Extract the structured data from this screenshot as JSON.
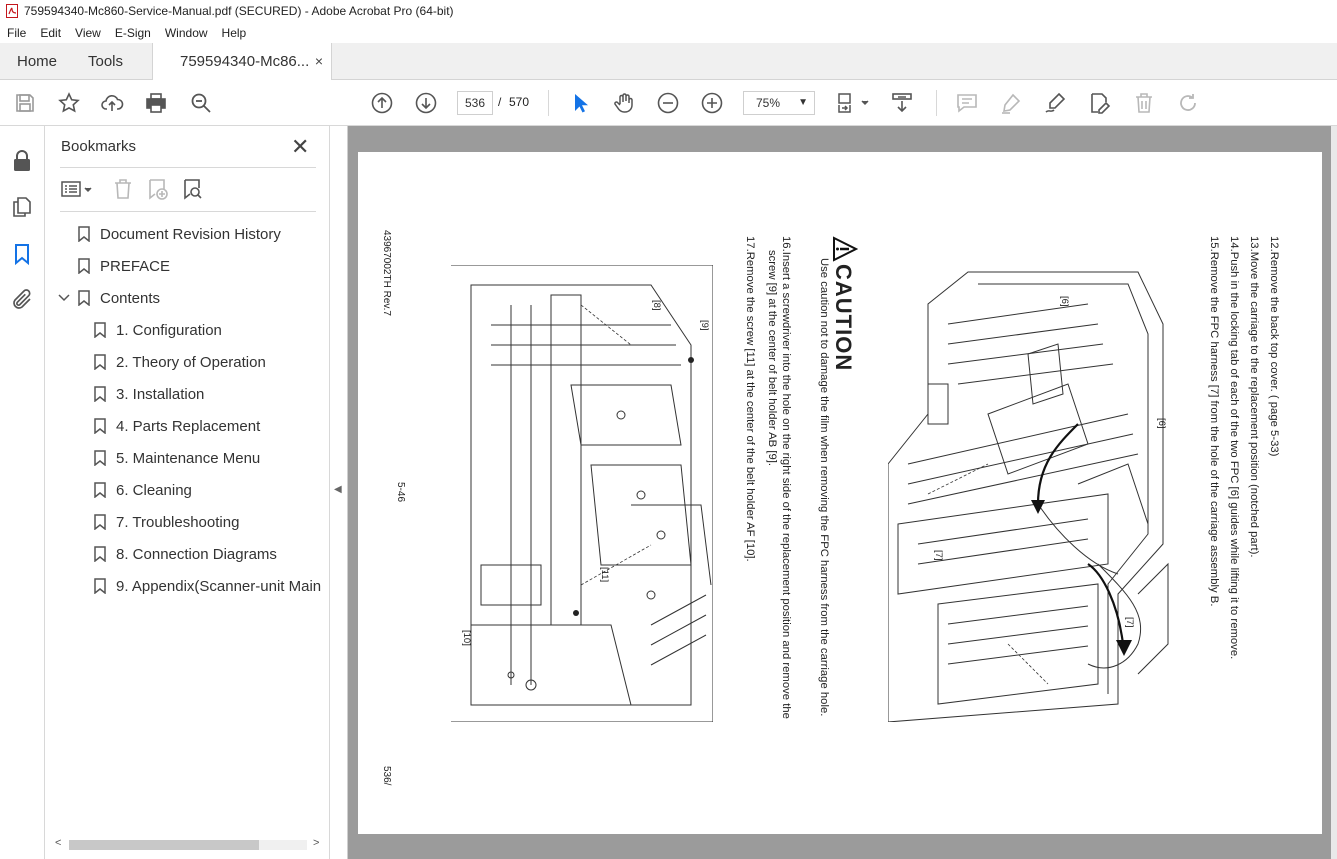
{
  "window": {
    "title": "759594340-Mc860-Service-Manual.pdf (SECURED) - Adobe Acrobat Pro (64-bit)"
  },
  "menu": [
    "File",
    "Edit",
    "View",
    "E-Sign",
    "Window",
    "Help"
  ],
  "tabs": {
    "home": "Home",
    "tools": "Tools",
    "document": "759594340-Mc86...",
    "close": "×"
  },
  "toolbar": {
    "current_page": "536",
    "separator": "/",
    "total_pages": "570",
    "zoom": "75%",
    "icons": [
      "save-icon",
      "star-icon",
      "upload-icon",
      "print-icon",
      "zoom-search-icon",
      "page-up-icon",
      "page-down-icon",
      "select-cursor-icon",
      "hand-icon",
      "zoom-out-icon",
      "zoom-in-icon",
      "fit-page-icon",
      "scroll-mode-icon",
      "comment-icon",
      "highlight-icon",
      "sign-icon",
      "edit-icon",
      "delete-icon",
      "redo-icon"
    ]
  },
  "rail": {
    "icons": [
      "lock-icon",
      "pages-icon",
      "bookmark-icon",
      "attachment-icon"
    ]
  },
  "bookmarks": {
    "title": "Bookmarks",
    "close": "✕",
    "items": [
      {
        "label": "Document Revision History",
        "level": 0
      },
      {
        "label": "PREFACE",
        "level": 0
      },
      {
        "label": "Contents",
        "level": 0,
        "expanded": true
      },
      {
        "label": "1. Configuration",
        "level": 1
      },
      {
        "label": "2. Theory of Operation",
        "level": 1
      },
      {
        "label": "3. Installation",
        "level": 1
      },
      {
        "label": "4. Parts Replacement",
        "level": 1
      },
      {
        "label": "5. Maintenance Menu",
        "level": 1
      },
      {
        "label": "6. Cleaning",
        "level": 1
      },
      {
        "label": "7. Troubleshooting",
        "level": 1
      },
      {
        "label": "8. Connection Diagrams",
        "level": 1
      },
      {
        "label": "9. Appendix(Scanner-unit Main",
        "level": 1
      }
    ]
  },
  "page": {
    "steps": [
      "12.Remove the back top cover. ( page 5-33)",
      "13.Move the carriage to the replacement position (notched part).",
      "14.Push in the locking tab of each of the two FPC [6] guides while lifting it to remove.",
      "15.Remove the FPC harness [7] from the hole of the carriage assembly B."
    ],
    "caution_title": "CAUTION",
    "caution_text": "Use caution not to damage the film when removing the FPC harness from the carriage hole.",
    "step16_line1": "16.Insert a screwdriver into the hole on the right side of the replacement position and remove the",
    "step16_line2": "screw [9] at the center of belt holder AB [9].",
    "step17": "17.Remove the screw [11] at the center of the belt holder AF [10].",
    "doc_id": "43967002TH  Rev.7",
    "page_label": "5-46",
    "page_footer": "536/",
    "callouts_top": [
      "[6]",
      "[6]",
      "[7]",
      "[7]"
    ],
    "callouts_bottom": [
      "[8]",
      "[9]",
      "[11]",
      "[10]"
    ]
  }
}
